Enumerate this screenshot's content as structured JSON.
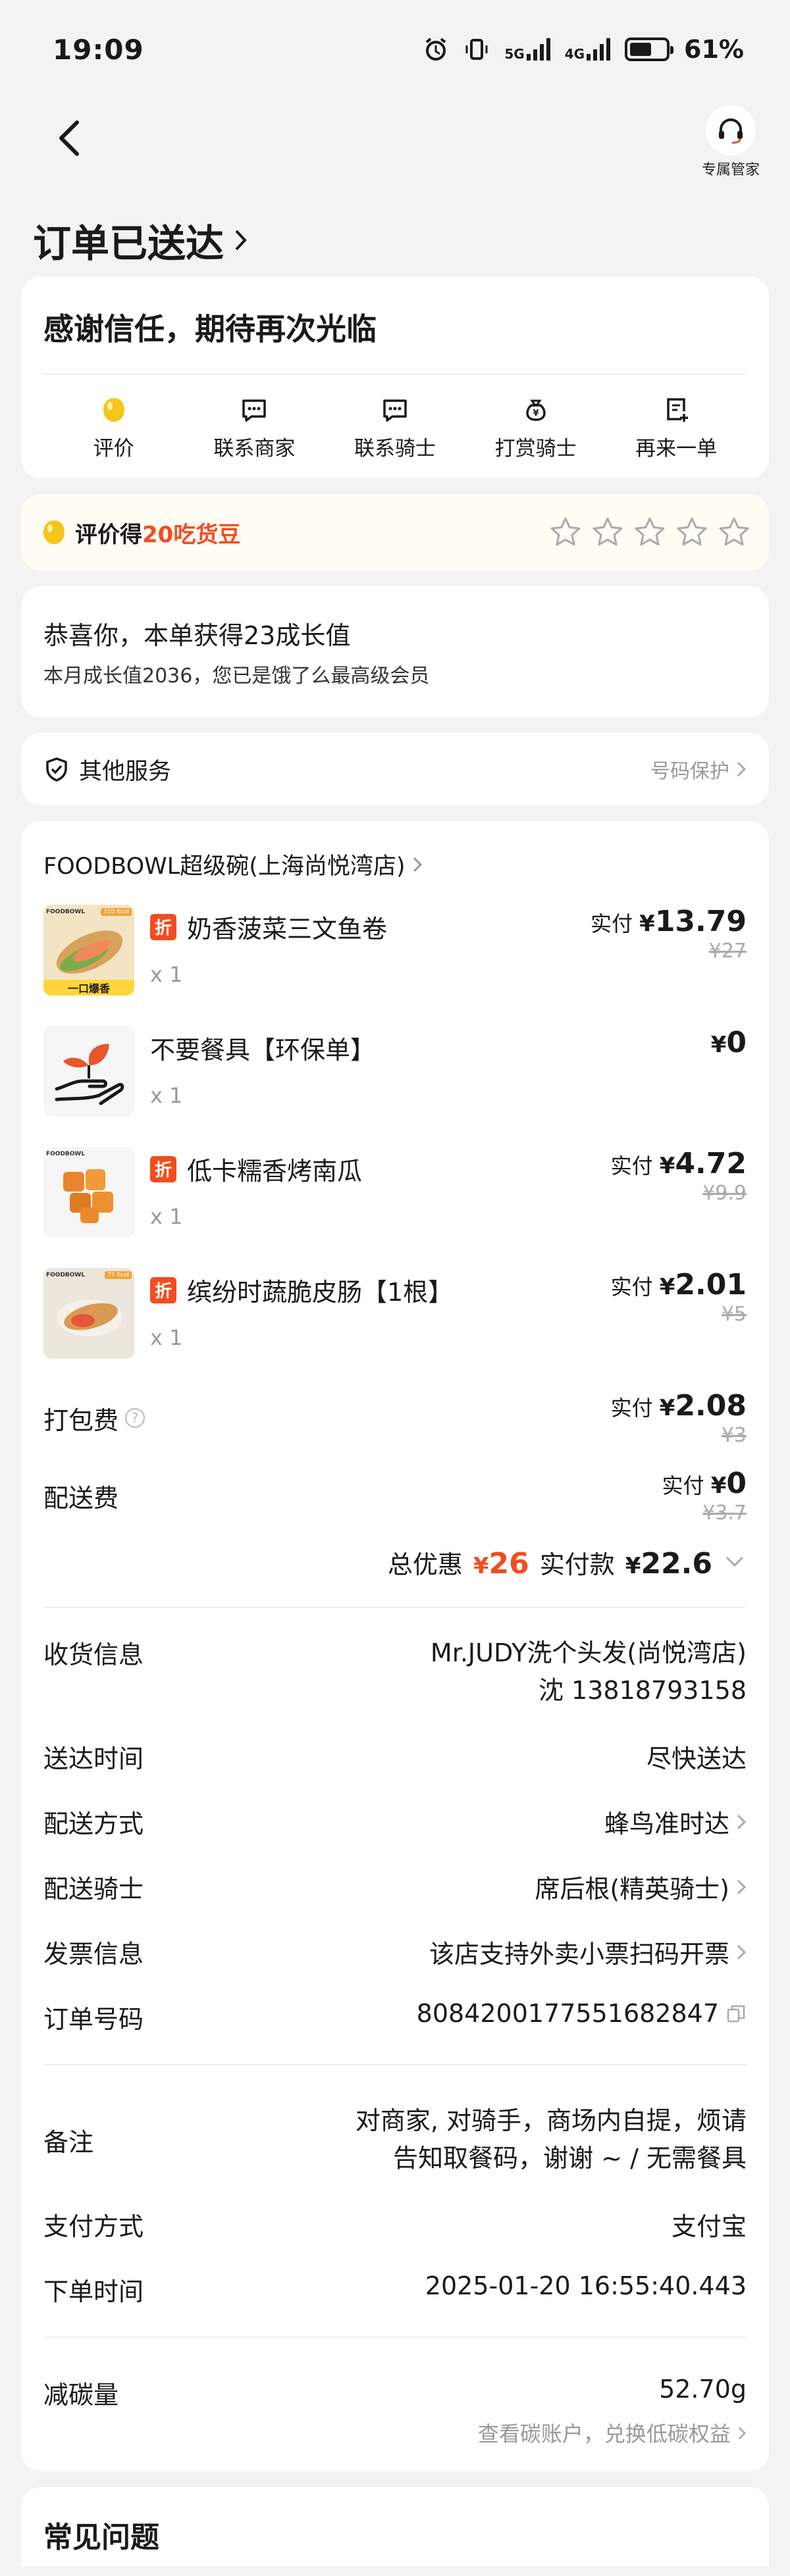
{
  "status_bar": {
    "time": "19:09",
    "network_1": "5G",
    "network_2": "4G",
    "battery": "61%"
  },
  "nav": {
    "butler_label": "专属管家"
  },
  "title": "订单已送达",
  "thanks": {
    "heading": "感谢信任，期待再次光临",
    "actions": [
      {
        "label": "评价",
        "icon": "rate-icon"
      },
      {
        "label": "联系商家",
        "icon": "chat-icon"
      },
      {
        "label": "联系骑士",
        "icon": "chat-icon"
      },
      {
        "label": "打赏骑士",
        "icon": "tip-icon"
      },
      {
        "label": "再来一单",
        "icon": "reorder-icon"
      }
    ]
  },
  "rate_banner": {
    "prefix": "评价得",
    "highlight": "20吃货豆",
    "star_count": 5
  },
  "growth": {
    "line1": "恭喜你，本单获得23成长值",
    "line2": "本月成长值2036，您已是饿了么最高级会员"
  },
  "services": {
    "label": "其他服务",
    "right": "号码保护"
  },
  "order": {
    "shop": "FOODBOWL超级碗(上海尚悦湾店)",
    "items": [
      {
        "name": "奶香菠菜三文鱼卷",
        "qty": "x 1",
        "discount": "折",
        "paid_label": "实付",
        "paid_sym": "¥",
        "paid": "13.79",
        "original": "¥27"
      },
      {
        "name": "不要餐具【环保单】",
        "qty": "x 1",
        "discount": "",
        "paid_label": "",
        "paid_sym": "¥",
        "paid": "0",
        "original": ""
      },
      {
        "name": "低卡糯香烤南瓜",
        "qty": "x 1",
        "discount": "折",
        "paid_label": "实付",
        "paid_sym": "¥",
        "paid": "4.72",
        "original": "¥9.9"
      },
      {
        "name": "缤纷时蔬脆皮肠【1根】",
        "qty": "x 1",
        "discount": "折",
        "paid_label": "实付",
        "paid_sym": "¥",
        "paid": "2.01",
        "original": "¥5"
      }
    ],
    "thumb_labels": {
      "brand": "FOODBOWL",
      "badge1": "一口爆香",
      "kcal1": "320 Kcal",
      "kcal4": "77 Kcal"
    },
    "packing_fee": {
      "label": "打包费",
      "paid_label": "实付",
      "sym": "¥",
      "paid": "2.08",
      "original": "¥3"
    },
    "delivery_fee": {
      "label": "配送费",
      "paid_label": "实付",
      "sym": "¥",
      "paid": "0",
      "original": "¥3.7"
    },
    "totals": {
      "discount_label": "总优惠",
      "discount_sym": "¥",
      "discount": "26",
      "paid_label": "实付款",
      "paid_sym": "¥",
      "paid": "22.6"
    }
  },
  "info": {
    "receiver_label": "收货信息",
    "receiver_line1": "Mr.JUDY洗个头发(尚悦湾店)",
    "receiver_line2": "沈 13818793158",
    "arrive_label": "送达时间",
    "arrive_value": "尽快送达",
    "method_label": "配送方式",
    "method_value": "蜂鸟准时达",
    "rider_label": "配送骑士",
    "rider_value": "席后根(精英骑士)",
    "invoice_label": "发票信息",
    "invoice_value": "该店支持外卖小票扫码开票",
    "order_no_label": "订单号码",
    "order_no_value": "8084200177551682847",
    "note_label": "备注",
    "note_line1": "对商家, 对骑手，商场内自提，烦请",
    "note_line2": "告知取餐码，谢谢 ~ / 无需餐具",
    "pay_label": "支付方式",
    "pay_value": "支付宝",
    "time_label": "下单时间",
    "time_value": "2025-01-20 16:55:40.443",
    "carbon_label": "减碳量",
    "carbon_value": "52.70g",
    "carbon_sub": "查看碳账户，兑换低碳权益"
  },
  "faq": {
    "title": "常见问题"
  },
  "colors": {
    "accent": "#f24d1f",
    "background": "#f3f3f3",
    "coin": "#f5c518"
  }
}
